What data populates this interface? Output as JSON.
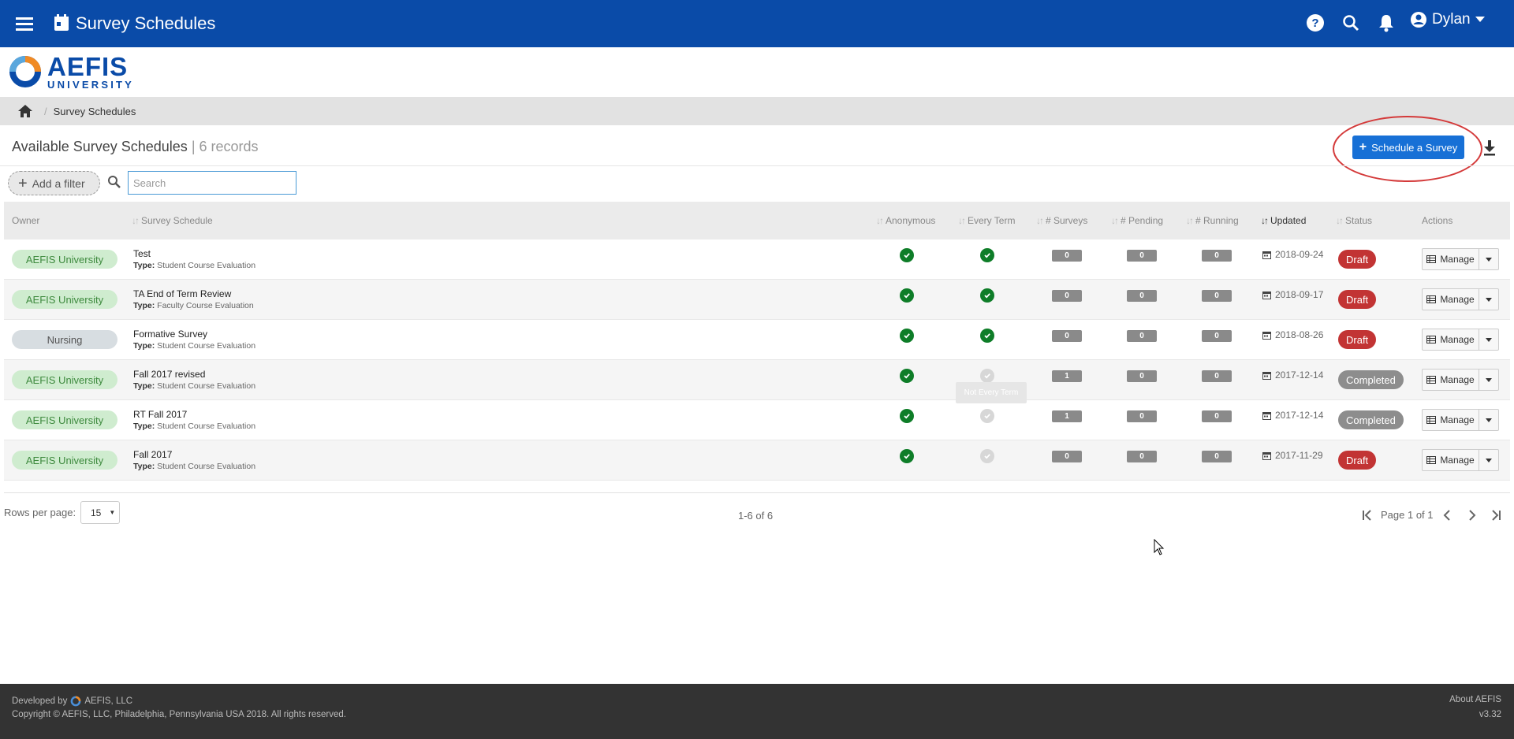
{
  "header": {
    "title": "Survey Schedules",
    "user_name": "Dylan"
  },
  "logo": {
    "name": "AEFIS",
    "subtitle": "UNIVERSITY"
  },
  "breadcrumb": {
    "current": "Survey Schedules"
  },
  "page": {
    "heading": "Available Survey Schedules",
    "record_count": "| 6 records",
    "schedule_button": "Schedule a Survey"
  },
  "filters": {
    "add_filter": "Add a filter",
    "search_placeholder": "Search"
  },
  "table": {
    "columns": {
      "owner": "Owner",
      "survey_schedule": "Survey Schedule",
      "anonymous": "Anonymous",
      "every_term": "Every Term",
      "surveys": "# Surveys",
      "pending": "# Pending",
      "running": "# Running",
      "updated": "Updated",
      "status": "Status",
      "actions": "Actions"
    },
    "type_label": "Type:",
    "manage_label": "Manage",
    "rows": [
      {
        "owner": "AEFIS University",
        "name": "Test",
        "type": "Student Course Evaluation",
        "anonymous": true,
        "every_term": true,
        "surveys": "0",
        "pending": "0",
        "running": "0",
        "updated": "2018-09-24",
        "status": "Draft"
      },
      {
        "owner": "AEFIS University",
        "name": "TA End of Term Review",
        "type": "Faculty Course Evaluation",
        "anonymous": true,
        "every_term": true,
        "surveys": "0",
        "pending": "0",
        "running": "0",
        "updated": "2018-09-17",
        "status": "Draft"
      },
      {
        "owner": "Nursing",
        "name": "Formative Survey",
        "type": "Student Course Evaluation",
        "anonymous": true,
        "every_term": true,
        "surveys": "0",
        "pending": "0",
        "running": "0",
        "updated": "2018-08-26",
        "status": "Draft"
      },
      {
        "owner": "AEFIS University",
        "name": "Fall 2017 revised",
        "type": "Student Course Evaluation",
        "anonymous": true,
        "every_term": false,
        "surveys": "1",
        "pending": "0",
        "running": "0",
        "updated": "2017-12-14",
        "status": "Completed"
      },
      {
        "owner": "AEFIS University",
        "name": "RT Fall 2017",
        "type": "Student Course Evaluation",
        "anonymous": true,
        "every_term": false,
        "surveys": "1",
        "pending": "0",
        "running": "0",
        "updated": "2017-12-14",
        "status": "Completed"
      },
      {
        "owner": "AEFIS University",
        "name": "Fall 2017",
        "type": "Student Course Evaluation",
        "anonymous": true,
        "every_term": false,
        "surveys": "0",
        "pending": "0",
        "running": "0",
        "updated": "2017-11-29",
        "status": "Draft"
      }
    ],
    "tooltip": "Not Every Term"
  },
  "pager": {
    "rows_per_page_label": "Rows per page:",
    "rows_per_page": "15",
    "range": "1-6 of 6",
    "page_of": "Page 1 of 1"
  },
  "footer": {
    "developed_by": "Developed by",
    "company": "AEFIS, LLC",
    "copyright": "Copyright © AEFIS, LLC, Philadelphia, Pennsylvania USA 2018. All rights reserved.",
    "about": "About AEFIS",
    "version": "v3.32"
  },
  "colors": {
    "brand_blue": "#0a4ba8",
    "button_blue": "#1770d6",
    "check_green": "#0e7d28",
    "draft_red": "#c23434",
    "annotation_red": "#d43a3a"
  },
  "icons": [
    "menu-icon",
    "calendar-icon",
    "help-icon",
    "search-icon",
    "bell-icon",
    "user-icon",
    "home-icon",
    "download-icon",
    "check-icon",
    "table-icon",
    "caret-down-icon",
    "first-page-icon",
    "prev-page-icon",
    "next-page-icon",
    "last-page-icon"
  ]
}
